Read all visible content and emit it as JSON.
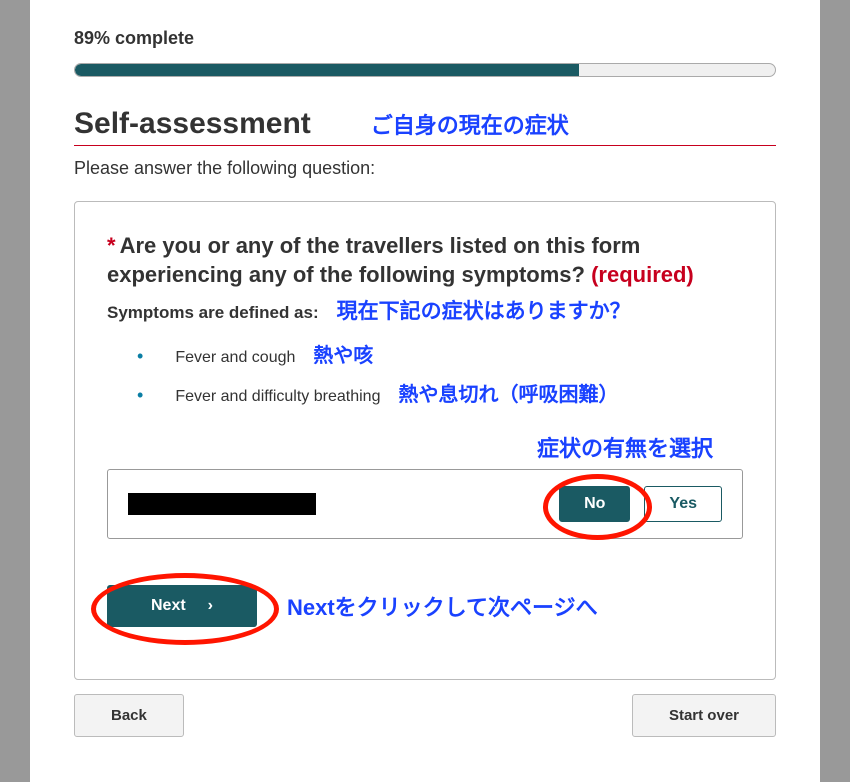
{
  "progress": {
    "text": "89% complete",
    "percent": 72
  },
  "heading": {
    "title": "Self-assessment",
    "jp": "ご自身の現在の症状"
  },
  "subhead": "Please answer the following question:",
  "question": {
    "text": "Are you or any of the travellers listed on this form experiencing any of the following symptoms?",
    "required": "(required)",
    "defined": "Symptoms are defined as:",
    "jp_defined": "現在下記の症状はありますか？"
  },
  "symptoms": [
    {
      "en": "Fever and cough",
      "jp": "熱や咳"
    },
    {
      "en": "Fever and difficulty breathing",
      "jp": "熱や息切れ（呼吸困難）"
    }
  ],
  "select_label_jp": "症状の有無を選択",
  "answers": {
    "no": "No",
    "yes": "Yes"
  },
  "next": {
    "label": "Next",
    "jp": "Nextをクリックして次ページへ"
  },
  "footer": {
    "back": "Back",
    "start_over": "Start over"
  }
}
